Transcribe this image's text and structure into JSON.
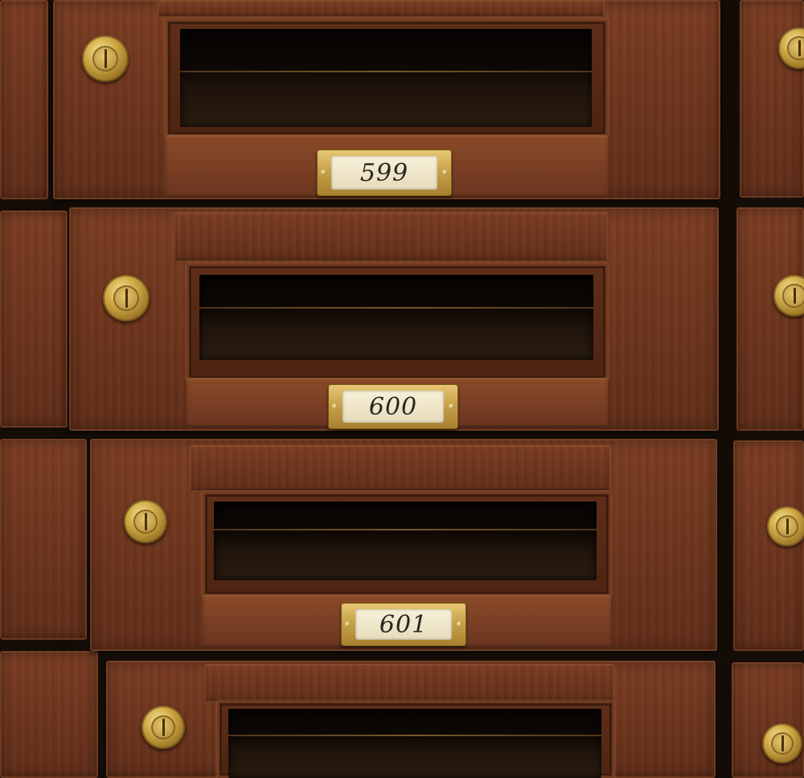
{
  "scene": "wooden-mailboxes",
  "colors": {
    "wood": "#6e351d",
    "brass": "#c9a24a",
    "slot": "#0e0805",
    "card": "#f2ead0"
  },
  "mailboxes": [
    {
      "number": "599"
    },
    {
      "number": "600"
    },
    {
      "number": "601"
    }
  ]
}
